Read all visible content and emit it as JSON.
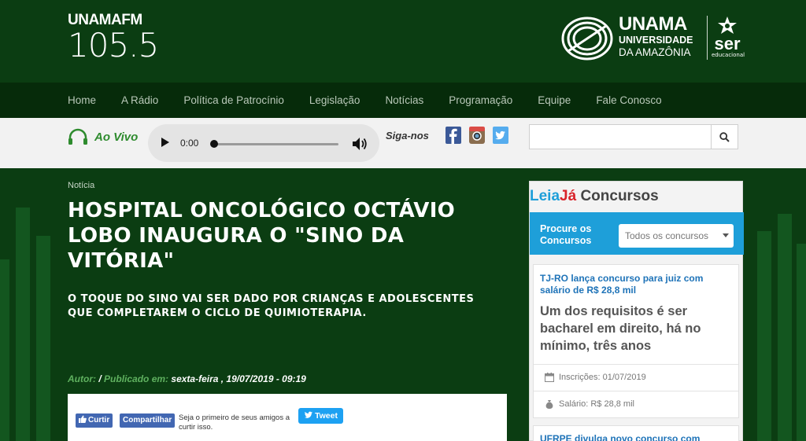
{
  "header": {
    "radio_logo_line1": "UNAMAFM",
    "radio_logo_line2": "105.5",
    "university_name": "UNAMA",
    "university_line2": "UNIVERSIDADE",
    "university_line3": "DA AMAZÔNIA",
    "ser_logo": "ser",
    "ser_sub": "educacional"
  },
  "nav": {
    "items": [
      "Home",
      "A Rádio",
      "Política de Patrocínio",
      "Legislação",
      "Notícias",
      "Programação",
      "Equipe",
      "Fale Conosco"
    ]
  },
  "player": {
    "live_label": "Ao Vivo",
    "time": "0:00",
    "progress": 0,
    "follow_label": "Siga-nos",
    "search_placeholder": ""
  },
  "article": {
    "category": "Notícia",
    "headline": "HOSPITAL ONCOLÓGICO OCTÁVIO LOBO INAUGURA O \"SINO DA VITÓRIA\"",
    "subheadline": "O TOQUE DO SINO VAI SER DADO POR CRIANÇAS E ADOLESCENTES QUE COMPLETAREM O CICLO DE QUIMIOTERAPIA.",
    "author_label": "Autor:",
    "slash": "/",
    "published_label": "Publicado em:",
    "published_value": "sexta-feira , 19/07/2019 - 09:19"
  },
  "share": {
    "fb_like": "Curtir",
    "fb_share": "Compartilhar",
    "fb_text": "Seja o primeiro de seus amigos a curtir isso.",
    "tweet": "Tweet"
  },
  "sidebar": {
    "brand_leia": "Leia",
    "brand_ja": "Já",
    "brand_rest": " Concursos",
    "search_label": "Procure os Concursos",
    "select_value": "Todos os concursos",
    "card1": {
      "title": "TJ-RO lança concurso para juiz com salário de R$ 28,8 mil",
      "desc": "Um dos requisitos é ser bacharel em direito, há no mínimo, três anos",
      "inscricoes": "Inscrições: 01/07/2019",
      "salario": "Salário: R$ 28,8 mil"
    },
    "card2": {
      "title": "UFRPE divulga novo concurso com"
    }
  },
  "colors": {
    "header_bg": "#0b3d12",
    "nav_bg": "#062b0a",
    "accent_green": "#2e8b2e",
    "leia_blue": "#1e9fd9",
    "ja_red": "#d9232a"
  }
}
